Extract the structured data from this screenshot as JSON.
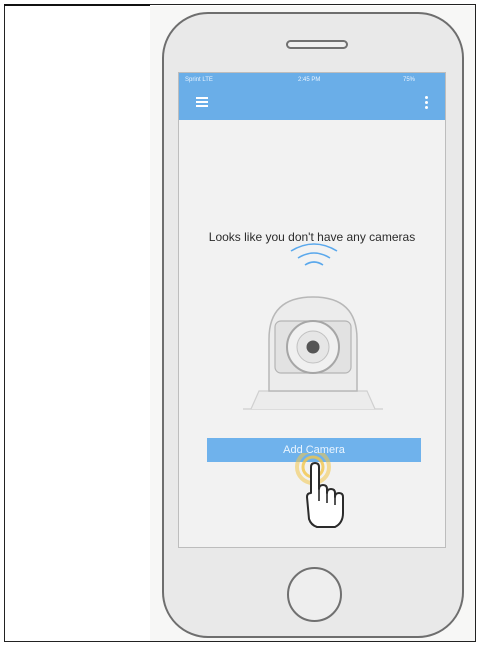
{
  "status_bar": {
    "carrier": "Sprint LTE",
    "time": "2:45 PM",
    "battery": "75%"
  },
  "empty_state": {
    "message": "Looks like you don't have any cameras"
  },
  "actions": {
    "add_camera": "Add Camera"
  },
  "colors": {
    "accent": "#6aaee8",
    "button": "#6fb2ec",
    "touch_highlight": "#f3c64a"
  },
  "icons": [
    "menu-icon",
    "kebab-menu-icon",
    "wifi-signal-icon",
    "camera-icon",
    "hand-pointer-icon"
  ]
}
